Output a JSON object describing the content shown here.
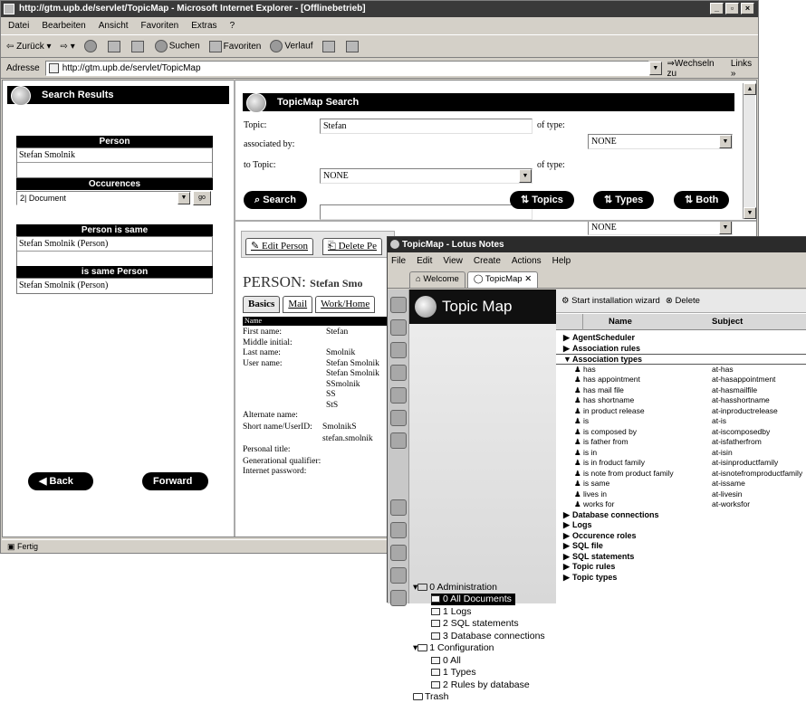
{
  "ie": {
    "title": "http://gtm.upb.de/servlet/TopicMap - Microsoft Internet Explorer - [Offlinebetrieb]",
    "menu": [
      "Datei",
      "Bearbeiten",
      "Ansicht",
      "Favoriten",
      "Extras",
      "?"
    ],
    "toolbar": {
      "back": "Zurück",
      "search": "Suchen",
      "favorites": "Favoriten",
      "history": "Verlauf"
    },
    "address_label": "Adresse",
    "address_value": "http://gtm.upb.de/servlet/TopicMap",
    "go_label": "Wechseln zu",
    "links_label": "Links »",
    "status": "Fertig"
  },
  "left": {
    "header": "Search Results",
    "person_hdr": "Person",
    "person_rows": [
      "Stefan Smolnik",
      ""
    ],
    "occ_hdr": "Occurences",
    "occ_select": "2| Document",
    "go_btn": "go",
    "same_hdr": "Person is same",
    "same_rows": [
      "Stefan Smolnik (Person)",
      ""
    ],
    "is_same_hdr": "is same Person",
    "is_same_rows": [
      "Stefan Smolnik (Person)"
    ],
    "back": "Back",
    "forward": "Forward"
  },
  "search": {
    "header": "TopicMap Search",
    "topic_label": "Topic:",
    "topic_value": "Stefan",
    "of_type_label": "of type:",
    "type1_value": "NONE",
    "assoc_label": "associated by:",
    "assoc_value": "NONE",
    "to_topic_label": "to Topic:",
    "to_topic_value": "",
    "type2_value": "NONE",
    "search_btn": "Search",
    "topics_btn": "Topics",
    "types_btn": "Types",
    "both_btn": "Both"
  },
  "person": {
    "edit_btn": "Edit Person",
    "delete_btn": "Delete Pe",
    "title": "PERSON:",
    "title_name": "Stefan Smo",
    "tabs": [
      "Basics",
      "Mail",
      "Work/Home"
    ],
    "name_hdr": "Name",
    "fields": [
      {
        "label": "First name:",
        "value": "Stefan"
      },
      {
        "label": "Middle initial:",
        "value": ""
      },
      {
        "label": "Last name:",
        "value": "Smolnik"
      },
      {
        "label": "User name:",
        "value": "Stefan Smolnik"
      },
      {
        "label": "",
        "value": "Stefan Smolnik"
      },
      {
        "label": "",
        "value": "SSmolnik"
      },
      {
        "label": "",
        "value": "SS"
      },
      {
        "label": "",
        "value": "StS"
      },
      {
        "label": "Alternate name:",
        "value": ""
      },
      {
        "label": "Short name/UserID:",
        "value": "SmolnikS"
      },
      {
        "label": "",
        "value": "stefan.smolnik"
      },
      {
        "label": "Personal title:",
        "value": ""
      },
      {
        "label": "Generational qualifier:",
        "value": ""
      },
      {
        "label": "Internet password:",
        "value": ""
      }
    ]
  },
  "notes": {
    "title": "TopicMap - Lotus Notes",
    "menu": [
      "File",
      "Edit",
      "View",
      "Create",
      "Actions",
      "Help"
    ],
    "tabs": [
      "Welcome",
      "TopicMap"
    ],
    "nav_header": "Topic Map",
    "tree": [
      {
        "label": "0 Administration",
        "level": 0,
        "selected": false
      },
      {
        "label": "0 All Documents",
        "level": 1,
        "selected": true
      },
      {
        "label": "1 Logs",
        "level": 1,
        "selected": false
      },
      {
        "label": "2 SQL statements",
        "level": 1,
        "selected": false
      },
      {
        "label": "3 Database connections",
        "level": 1,
        "selected": false
      },
      {
        "label": "1 Configuration",
        "level": 0,
        "selected": false
      },
      {
        "label": "0 All",
        "level": 1,
        "selected": false
      },
      {
        "label": "1 Types",
        "level": 1,
        "selected": false
      },
      {
        "label": "2 Rules by database",
        "level": 1,
        "selected": false
      },
      {
        "label": "Trash",
        "level": 0,
        "selected": false
      }
    ],
    "wizard_btn": "Start installation wizard",
    "delete_btn": "Delete",
    "col_name": "Name",
    "col_subject": "Subject",
    "rows": [
      {
        "type": "cat",
        "name": "AgentScheduler",
        "subject": ""
      },
      {
        "type": "cat",
        "name": "Association rules",
        "subject": ""
      },
      {
        "type": "cat-open",
        "name": "Association types",
        "subject": ""
      },
      {
        "type": "doc",
        "name": "has",
        "subject": "at-has"
      },
      {
        "type": "doc",
        "name": "has appointment",
        "subject": "at-hasappointment"
      },
      {
        "type": "doc",
        "name": "has mail file",
        "subject": "at-hasmailfile"
      },
      {
        "type": "doc",
        "name": "has shortname",
        "subject": "at-hasshortname"
      },
      {
        "type": "doc",
        "name": "in product release",
        "subject": "at-inproductrelease"
      },
      {
        "type": "doc",
        "name": "is",
        "subject": "at-is"
      },
      {
        "type": "doc",
        "name": "is composed by",
        "subject": "at-iscomposedby"
      },
      {
        "type": "doc",
        "name": "is father from",
        "subject": "at-isfatherfrom"
      },
      {
        "type": "doc",
        "name": "is in",
        "subject": "at-isin"
      },
      {
        "type": "doc",
        "name": "is in froduct family",
        "subject": "at-isinproductfamily"
      },
      {
        "type": "doc",
        "name": "is note from product family",
        "subject": "at-isnotefromproductfamily"
      },
      {
        "type": "doc",
        "name": "is same",
        "subject": "at-issame"
      },
      {
        "type": "doc",
        "name": "lives in",
        "subject": "at-livesin"
      },
      {
        "type": "doc",
        "name": "works for",
        "subject": "at-worksfor"
      },
      {
        "type": "cat",
        "name": "Database connections",
        "subject": ""
      },
      {
        "type": "cat",
        "name": "Logs",
        "subject": ""
      },
      {
        "type": "cat",
        "name": "Occurence roles",
        "subject": ""
      },
      {
        "type": "cat",
        "name": "SQL file",
        "subject": ""
      },
      {
        "type": "cat",
        "name": "SQL statements",
        "subject": ""
      },
      {
        "type": "cat",
        "name": "Topic rules",
        "subject": ""
      },
      {
        "type": "cat",
        "name": "Topic types",
        "subject": ""
      }
    ]
  }
}
